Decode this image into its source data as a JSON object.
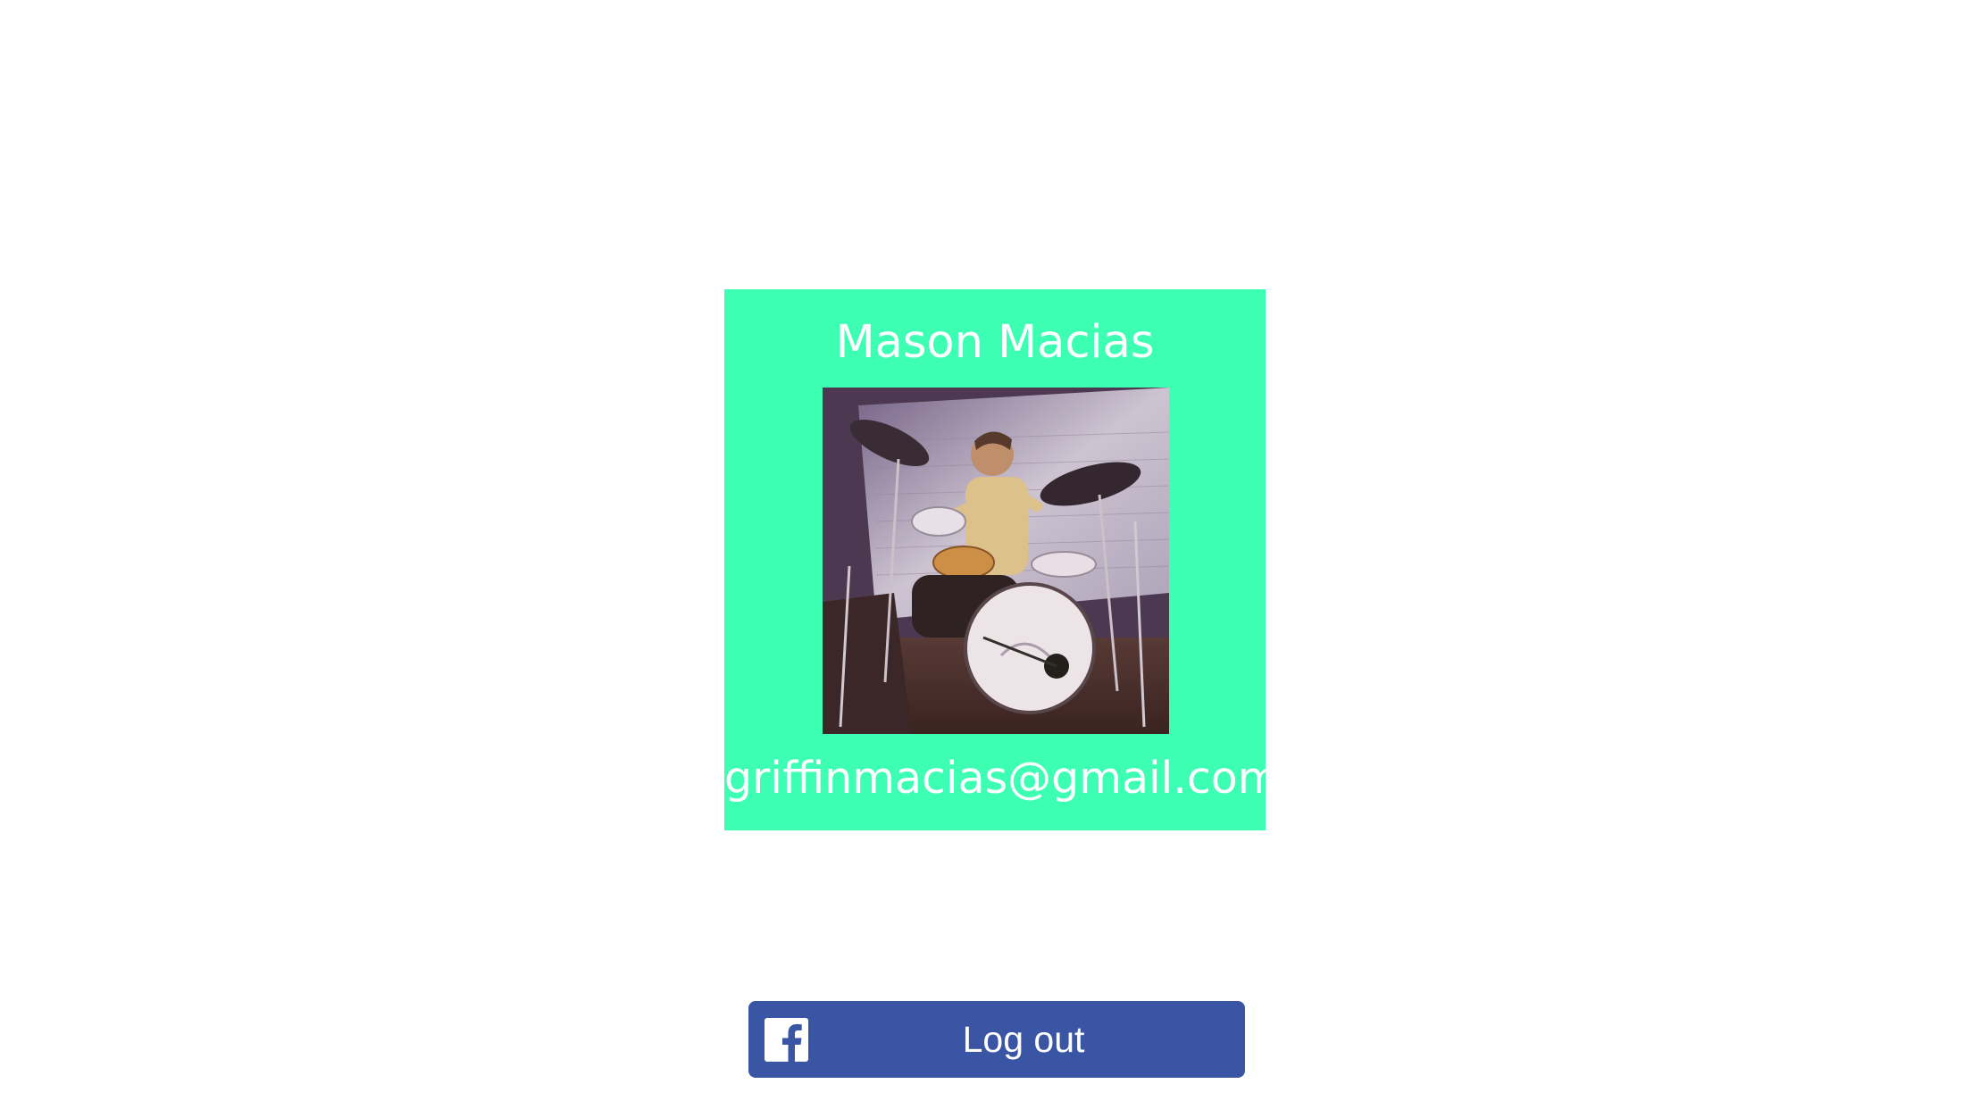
{
  "profile": {
    "name": "Mason Macias",
    "email": "griffinmacias@gmail.com",
    "photo_alt": "Profile photo",
    "card_color": "#3dffb4"
  },
  "logout": {
    "label": "Log out",
    "icon": "facebook-icon",
    "color": "#3b55a5"
  }
}
